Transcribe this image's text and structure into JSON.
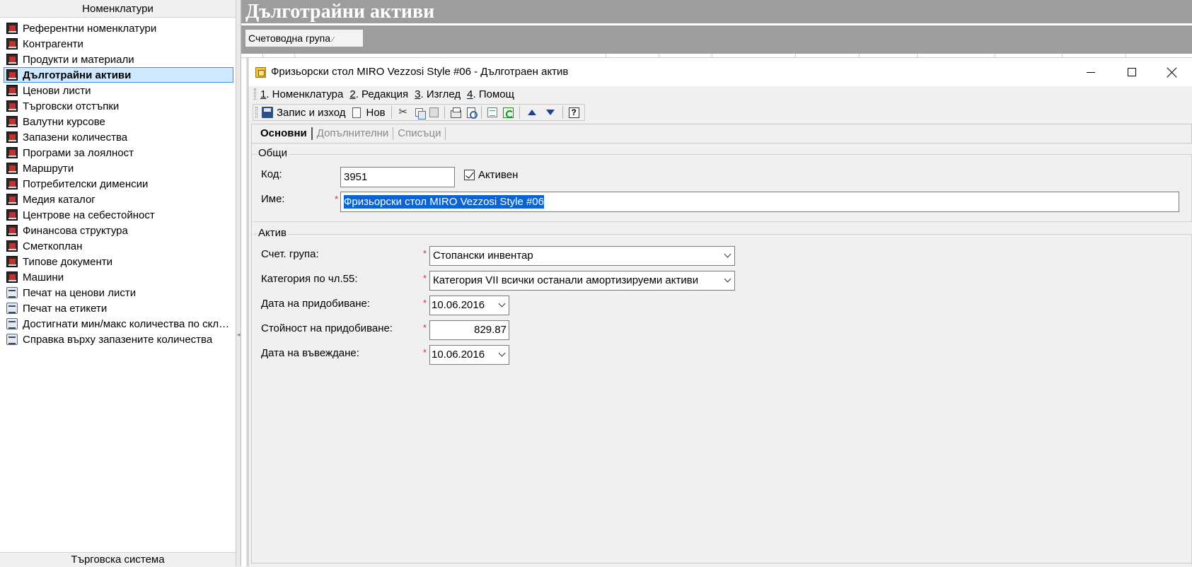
{
  "left_pane": {
    "header": "Номенклатури",
    "footer": "Търговска система",
    "items": [
      {
        "label": "Референтни номенклатури",
        "icon": "nomenclature-icon"
      },
      {
        "label": "Контрагенти",
        "icon": "nomenclature-icon"
      },
      {
        "label": "Продукти и материали",
        "icon": "nomenclature-icon"
      },
      {
        "label": "Дълготрайни активи",
        "icon": "nomenclature-icon",
        "selected": true
      },
      {
        "label": "Ценови листи",
        "icon": "nomenclature-icon"
      },
      {
        "label": "Търговски отстъпки",
        "icon": "nomenclature-icon"
      },
      {
        "label": "Валутни курсове",
        "icon": "nomenclature-icon"
      },
      {
        "label": "Запазени количества",
        "icon": "nomenclature-icon"
      },
      {
        "label": "Програми за лоялност",
        "icon": "nomenclature-icon"
      },
      {
        "label": "Маршрути",
        "icon": "nomenclature-icon"
      },
      {
        "label": "Потребителски дименсии",
        "icon": "nomenclature-icon"
      },
      {
        "label": "Медия каталог",
        "icon": "nomenclature-icon"
      },
      {
        "label": "Центрове на себестойност",
        "icon": "nomenclature-icon"
      },
      {
        "label": "Финансова структура",
        "icon": "nomenclature-icon"
      },
      {
        "label": "Сметкоплан",
        "icon": "nomenclature-icon"
      },
      {
        "label": "Типове документи",
        "icon": "nomenclature-icon"
      },
      {
        "label": "Машини",
        "icon": "nomenclature-icon"
      },
      {
        "label": "Печат на ценови листи",
        "icon": "report-icon"
      },
      {
        "label": "Печат на етикети",
        "icon": "report-icon"
      },
      {
        "label": "Достигнати мин/макс количества по скла...",
        "icon": "report-icon"
      },
      {
        "label": "Справка върху запазените количества",
        "icon": "report-icon"
      }
    ]
  },
  "main": {
    "page_title": "Дълготрайни активи",
    "group_chip": "Счетоводна група",
    "group_chip_sort": "⁄"
  },
  "dialog": {
    "title": "Фризьорски стол MIRO Vezzosi Style #06 - Дълготраен актив",
    "menu": [
      {
        "key": "1",
        "label": ". Номенклатура"
      },
      {
        "key": "2",
        "label": ". Редакция"
      },
      {
        "key": "3",
        "label": ". Изглед"
      },
      {
        "key": "4",
        "label": ". Помощ"
      }
    ],
    "toolbar": {
      "save_exit": "Запис и изход",
      "new": "Нов"
    },
    "tabs": [
      "Основни",
      "Допълнителни",
      "Списъци"
    ],
    "general": {
      "title": "Общи",
      "code_label": "Код:",
      "code_value": "3951",
      "active_label": "Активен",
      "active_checked": true,
      "name_label": "Име:",
      "name_value": "Фризьорски стол MIRO Vezzosi Style #06"
    },
    "asset": {
      "title": "Актив",
      "account_group_label": "Счет. група:",
      "account_group_value": "Стопански инвентар",
      "category_label": "Категория по чл.55:",
      "category_value": "Категория VII всички останали амортизируеми активи",
      "acq_date_label": "Дата на придобиване:",
      "acq_date_value": "10.06.2016",
      "acq_value_label": "Стойност на придобиване:",
      "acq_value_value": "829.87",
      "entry_date_label": "Дата на въвеждане:",
      "entry_date_value": "10.06.2016"
    },
    "required_marker": "*"
  },
  "colors": {
    "selection_bg": "#cde8ff",
    "selection_border": "#3d8ee0",
    "title_bar_gray": "#9d9d9d",
    "required_red": "#d03030",
    "text_highlight": "#0a64d6"
  }
}
